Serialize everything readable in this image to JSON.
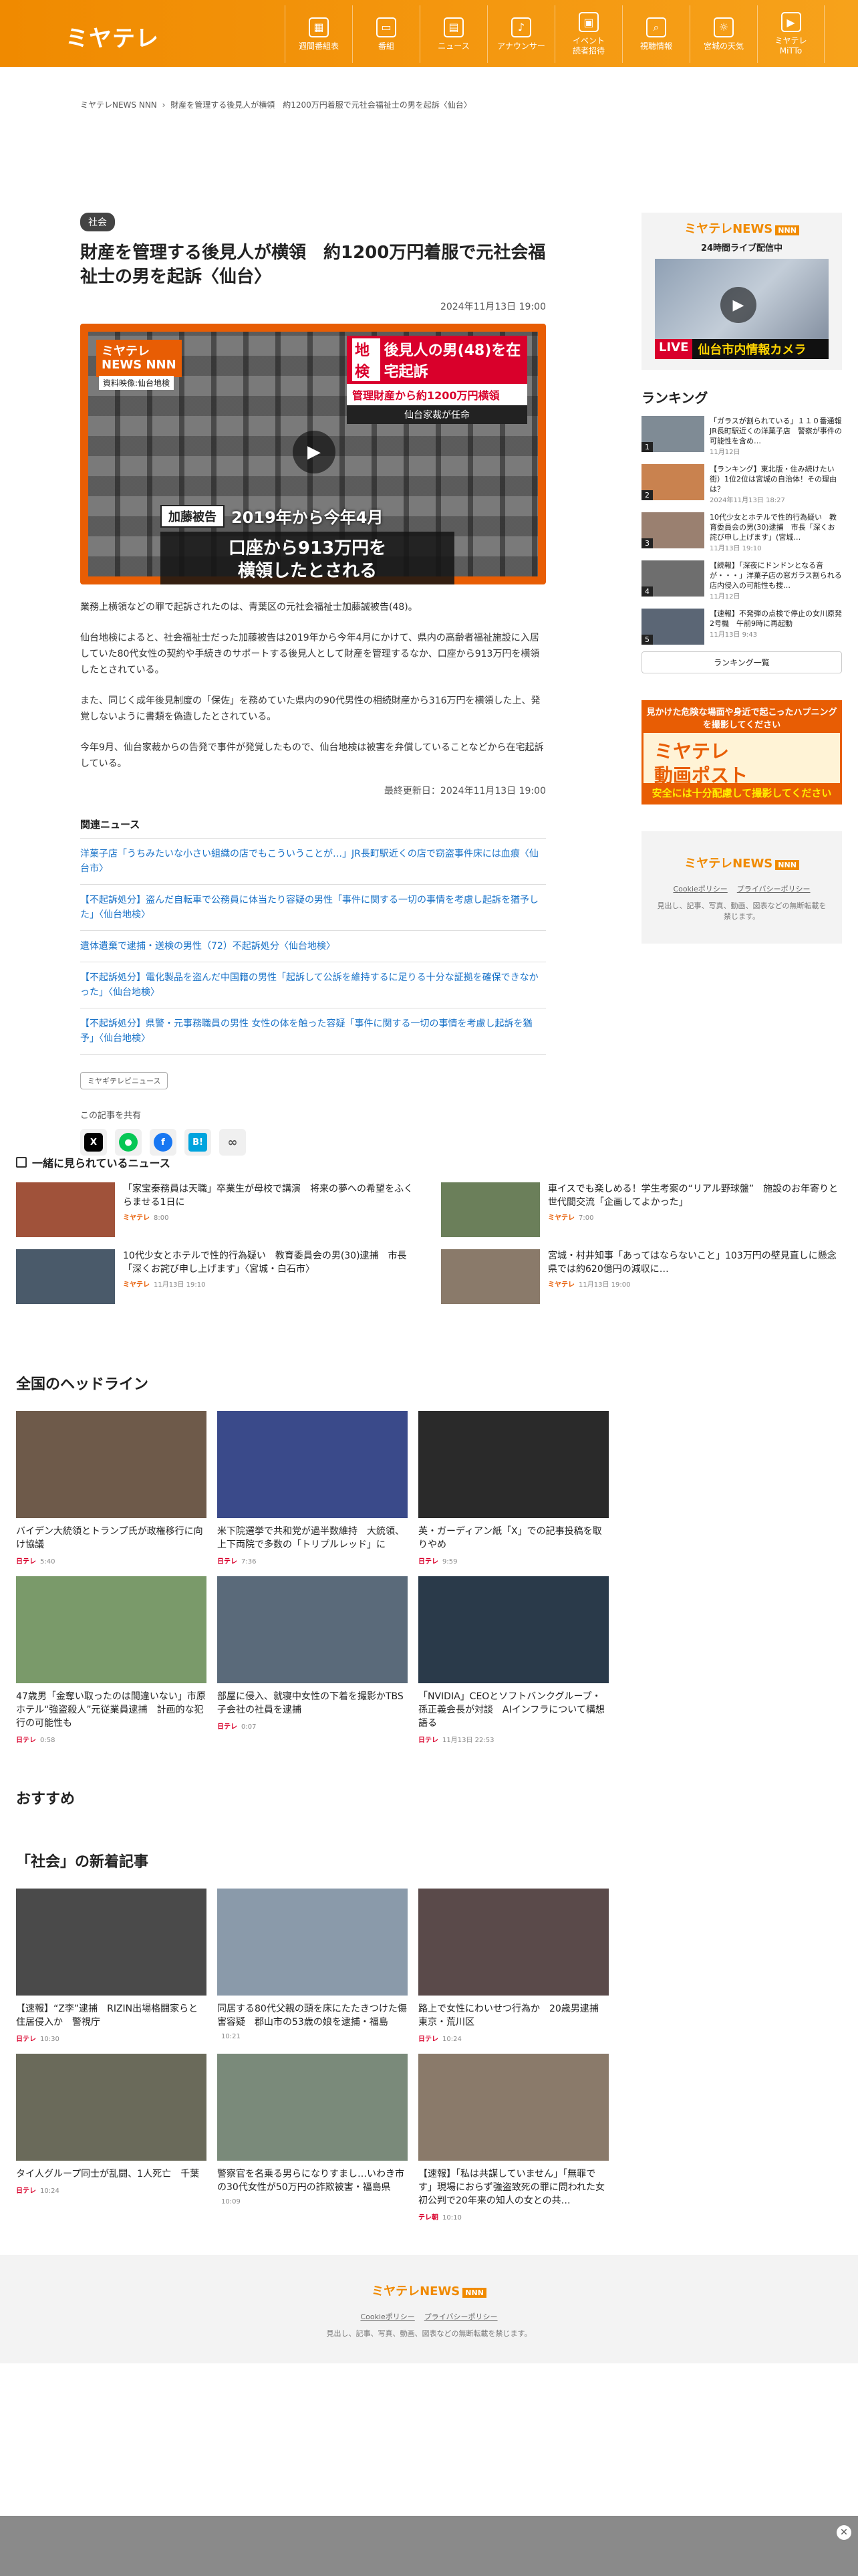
{
  "header": {
    "logo": "ミヤテレ",
    "nav": [
      {
        "icon": "calendar-icon",
        "glyph": "▦",
        "label": "週間番組表"
      },
      {
        "icon": "tv-icon",
        "glyph": "▭",
        "label": "番組"
      },
      {
        "icon": "news-icon",
        "glyph": "▤",
        "label": "ニュース"
      },
      {
        "icon": "mic-icon",
        "glyph": "♪",
        "label": "アナウンサー"
      },
      {
        "icon": "event-icon",
        "glyph": "▣",
        "label": "イベント\n読者招待"
      },
      {
        "icon": "search-icon",
        "glyph": "⌕",
        "label": "視聴情報"
      },
      {
        "icon": "weather-icon",
        "glyph": "☼",
        "label": "宮城の天気"
      },
      {
        "icon": "play-icon",
        "glyph": "▶",
        "label": "ミヤテレ\nMiTTo"
      }
    ]
  },
  "breadcrumb": [
    "ミヤテレNEWS NNN",
    "›",
    "財産を管理する後見人が横領　約1200万円着服で元社会福祉士の男を起訴〈仙台〉"
  ],
  "article": {
    "category": "社会",
    "title": "財産を管理する後見人が横領　約1200万円着服で元社会福祉士の男を起訴〈仙台〉",
    "date": "2024年11月13日 19:00",
    "video": {
      "logo": "ミヤテレ\nNEWS NNN",
      "source": "資料映像:仙台地検",
      "tag_area": "地検",
      "tag_main": "後見人の男(48)を在宅起訴",
      "tag_sub": "管理財産から約1200万円横領",
      "tag_place": "仙台家裁が任命",
      "cap_name": "加藤被告",
      "cap_period": "2019年から今年4月",
      "cap_main": "口座から913万円を\n横領したとされる"
    },
    "paragraphs": [
      "業務上横領などの罪で起訴されたのは、青葉区の元社会福祉士加藤誠被告(48)。",
      "仙台地検によると、社会福祉士だった加藤被告は2019年から今年4月にかけて、県内の高齢者福祉施設に入居していた80代女性の契約や手続きのサポートする後見人として財産を管理するなか、口座から913万円を横領したとされている。",
      "また、同じく成年後見制度の「保佐」を務めていた県内の90代男性の相続財産から316万円を横領した上、発覚しないように書類を偽造したとされている。",
      "今年9月、仙台家裁からの告発で事件が発覚したもので、仙台地検は被害を弁償していることなどから在宅起訴している。"
    ],
    "updated": "最終更新日：2024年11月13日 19:00",
    "related_heading": "関連ニュース",
    "related": [
      "洋菓子店「うちみたいな小さい組織の店でもこういうことが…」JR長町駅近くの店で窃盗事件床には血痕〈仙台市〉",
      "【不起訴処分】盗んだ自転車で公務員に体当たり容疑の男性「事件に関する一切の事情を考慮し起訴を猶予した」〈仙台地検〉",
      "遺体遺棄で逮捕・送検の男性（72）不起訴処分〈仙台地検〉",
      "【不起訴処分】電化製品を盗んだ中国籍の男性「起訴して公訴を維持するに足りる十分な証拠を確保できなかった」〈仙台地検〉",
      "【不起訴処分】県警・元事務職員の男性 女性の体を触った容疑「事件に関する一切の事情を考慮し起訴を猶予」〈仙台地検〉"
    ],
    "tag": "ミヤギテレビニュース",
    "share_heading": "この記事を共有"
  },
  "sidebar": {
    "live_logo": "ミヤテレNEWS",
    "live_logo_badge": "NNN",
    "live_sub": "24時間ライブ配信中",
    "live_label": "LIVE",
    "live_caption": "仙台市内情報カメラ",
    "ranking_heading": "ランキング",
    "ranking": [
      {
        "title": "「ガラスが割られている」１１０番通報　JR長町駅近くの洋菓子店　警察が事件の可能性を含め…",
        "date": "11月12日"
      },
      {
        "title": "【ランキング】東北版・住み続けたい街）1位2位は宮城の自治体！その理由は？",
        "date": "2024年11月13日 18:27"
      },
      {
        "title": "10代少女とホテルで性的行為疑い　教育委員会の男(30)逮捕　市長「深くお詫び申し上げます」(宮城…",
        "date": "11月13日 19:10"
      },
      {
        "title": "【続報】「深夜にドンドンとなる音が・・・」洋菓子店の窓ガラス割られる　店内侵入の可能性も捜…",
        "date": "11月12日"
      },
      {
        "title": "【速報】不発弾の点検で停止の女川原発2号機　午前9時に再起動",
        "date": "11月13日 9:43"
      }
    ],
    "ranking_button": "ランキング一覧",
    "post_top": "見かけた危険な場面や身近で起こったハプニングを撮影してください",
    "post_main": "ミヤテレ\n動画ポスト",
    "post_bottom": "安全には十分配慮して撮影してください",
    "foot_logo": "ミヤテレNEWS",
    "foot_badge": "NNN",
    "foot_links": [
      "Cookieポリシー",
      "プライバシーポリシー"
    ],
    "foot_note": "見出し、記事、写真、動画、図表などの無断転載を禁じます。"
  },
  "sub": {
    "heading": "一緒に見られているニュース",
    "items": [
      {
        "title": "「家宝秦務員は天職」卒業生が母校で講演　将来の夢への希望をふくらませる1日に",
        "src": "ミヤテレ",
        "date": "8:00"
      },
      {
        "title": "車イスでも楽しめる！学生考案の“リアル野球盤”　施設のお年寄りと世代間交流「企画してよかった」",
        "src": "ミヤテレ",
        "date": "7:00"
      },
      {
        "title": "10代少女とホテルで性的行為疑い　教育委員会の男(30)逮捕　市長「深くお詫び申し上げます」〈宮城・白石市〉",
        "src": "ミヤテレ",
        "date": "11月13日 19:10"
      },
      {
        "title": "宮城・村井知事「あってはならないこと」103万円の壁見直しに懸念　県では約620億円の減収に…",
        "src": "ミヤテレ",
        "date": "11月13日 19:00"
      }
    ]
  },
  "headlines": {
    "heading": "全国のヘッドライン",
    "items": [
      {
        "title": "バイデン大統領とトランプ氏が政権移行に向け協議",
        "src": "日テレ",
        "date": "5:40"
      },
      {
        "title": "米下院選挙で共和党が過半数維持　大統領、上下両院で多数の「トリプルレッド」に",
        "src": "日テレ",
        "date": "7:36"
      },
      {
        "title": "英・ガーディアン紙「X」での記事投稿を取りやめ",
        "src": "日テレ",
        "date": "9:59"
      },
      {
        "title": "47歳男「金奪い取ったのは間違いない」市原ホテル“強盗殺人”元従業員逮捕　計画的な犯行の可能性も",
        "src": "日テレ",
        "date": "0:58"
      },
      {
        "title": "部屋に侵入、就寝中女性の下着を撮影かTBS子会社の社員を逮捕",
        "src": "日テレ",
        "date": "0:07"
      },
      {
        "title": "「NVIDIA」CEOとソフトバンクグループ・孫正義会長が対談　AIインフラについて構想語る",
        "src": "日テレ",
        "date": "11月13日 22:53"
      }
    ]
  },
  "recommend": {
    "heading": "おすすめ"
  },
  "shakai": {
    "heading": "「社会」の新着記事",
    "items": [
      {
        "title": "【速報】“Z李”逮捕　RIZIN出場格闘家らと住居侵入か　警視庁",
        "src": "日テレ",
        "date": "10:30"
      },
      {
        "title": "同居する80代父親の頭を床にたたきつけた傷害容疑　郡山市の53歳の娘を逮捕・福島",
        "src": "",
        "date": "10:21"
      },
      {
        "title": "路上で女性にわいせつ行為か　20歳男逮捕　東京・荒川区",
        "src": "日テレ",
        "date": "10:24"
      },
      {
        "title": "タイ人グループ同士が乱闘、1人死亡　千葉",
        "src": "日テレ",
        "date": "10:24"
      },
      {
        "title": "警察官を名乗る男らになりすまし…いわき市の30代女性が50万円の詐欺被害・福島県",
        "src": "",
        "date": "10:09"
      },
      {
        "title": "【速報】「私は共謀していません」「無罪です」現場におらず強盗致死の罪に問われた女　初公判で20年来の知人の女との共…",
        "src": "テレ朝",
        "date": "10:10"
      }
    ]
  },
  "footer": {
    "logo": "ミヤテレNEWS",
    "badge": "NNN",
    "links": [
      "Cookieポリシー",
      "プライバシーポリシー"
    ],
    "note": "見出し、記事、写真、動画、図表などの無断転載を禁じます。"
  }
}
